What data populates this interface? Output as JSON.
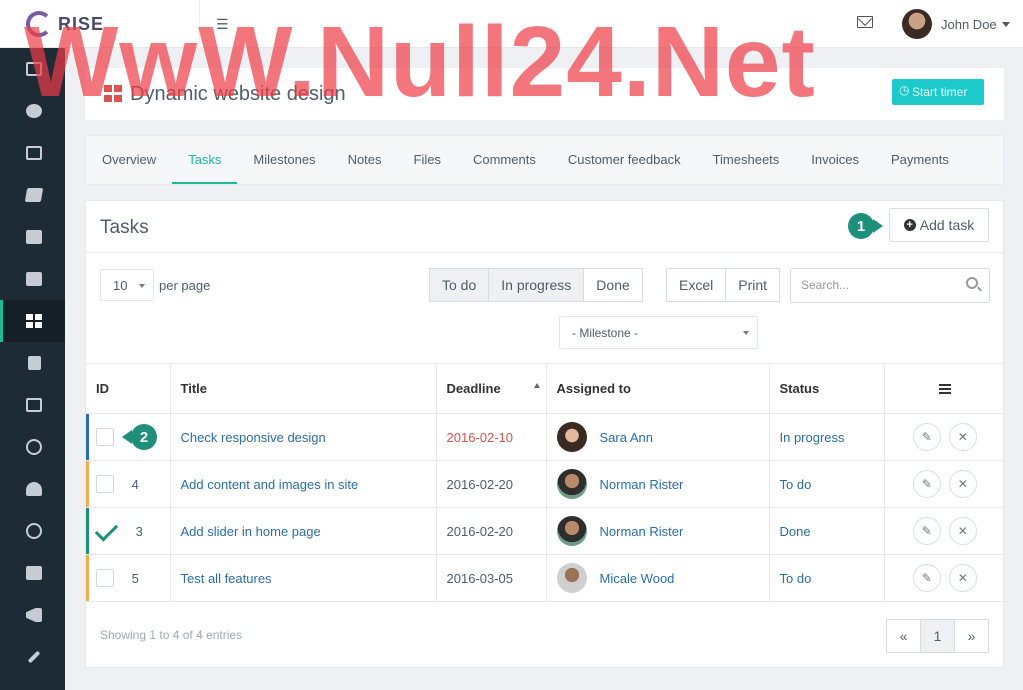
{
  "app": {
    "name": "RISE"
  },
  "user": {
    "name": "John Doe"
  },
  "sidebar": {
    "items": [
      {
        "icon": "dashboard-icon"
      },
      {
        "icon": "chat-icon"
      },
      {
        "icon": "calendar-icon"
      },
      {
        "icon": "notes-icon"
      },
      {
        "icon": "mail-icon"
      },
      {
        "icon": "briefcase-icon"
      },
      {
        "icon": "projects-icon",
        "active": true
      },
      {
        "icon": "invoice-icon"
      },
      {
        "icon": "payments-icon"
      },
      {
        "icon": "support-icon"
      },
      {
        "icon": "user-icon"
      },
      {
        "icon": "clock-icon"
      },
      {
        "icon": "signout-icon"
      },
      {
        "icon": "announcement-icon"
      },
      {
        "icon": "settings-icon"
      }
    ]
  },
  "project": {
    "title": "Dynamic website design",
    "start_timer": "Start timer"
  },
  "tabs": [
    "Overview",
    "Tasks",
    "Milestones",
    "Notes",
    "Files",
    "Comments",
    "Customer feedback",
    "Timesheets",
    "Invoices",
    "Payments"
  ],
  "active_tab": "Tasks",
  "panel": {
    "title": "Tasks",
    "add_task": "Add task"
  },
  "markers": [
    "1",
    "2"
  ],
  "controls": {
    "per_page_value": "10",
    "per_page_label": "per page",
    "status_filters": [
      "To do",
      "In progress",
      "Done"
    ],
    "export": [
      "Excel",
      "Print"
    ],
    "search_placeholder": "Search...",
    "milestone": "- Milestone -"
  },
  "table": {
    "headers": [
      "ID",
      "Title",
      "Deadline",
      "Assigned to",
      "Status"
    ],
    "rows": [
      {
        "id": "",
        "title": "Check responsive design",
        "deadline": "2016-02-10",
        "assignee": "Sara Ann",
        "status": "In progress",
        "overdue": true,
        "bar": "#2b6ea6"
      },
      {
        "id": "4",
        "title": "Add content and images in site",
        "deadline": "2016-02-20",
        "assignee": "Norman Rister",
        "status": "To do",
        "bar": "#f0ad4e"
      },
      {
        "id": "3",
        "title": "Add slider in home page",
        "deadline": "2016-02-20",
        "assignee": "Norman Rister",
        "status": "Done",
        "done": true,
        "bar": "#1d8f7a"
      },
      {
        "id": "5",
        "title": "Test all features",
        "deadline": "2016-03-05",
        "assignee": "Micale Wood",
        "status": "To do",
        "bar": "#f0ad4e"
      }
    ]
  },
  "footer": {
    "showing": "Showing 1 to 4 of 4 entries",
    "pages": [
      "«",
      "1",
      "»"
    ]
  },
  "watermark": "WwW.Null24.Net",
  "colors": {
    "accent": "#1bbc9b",
    "sidebar": "#1c2b36",
    "link": "#2b6ea6",
    "overdue": "#d9534f"
  }
}
